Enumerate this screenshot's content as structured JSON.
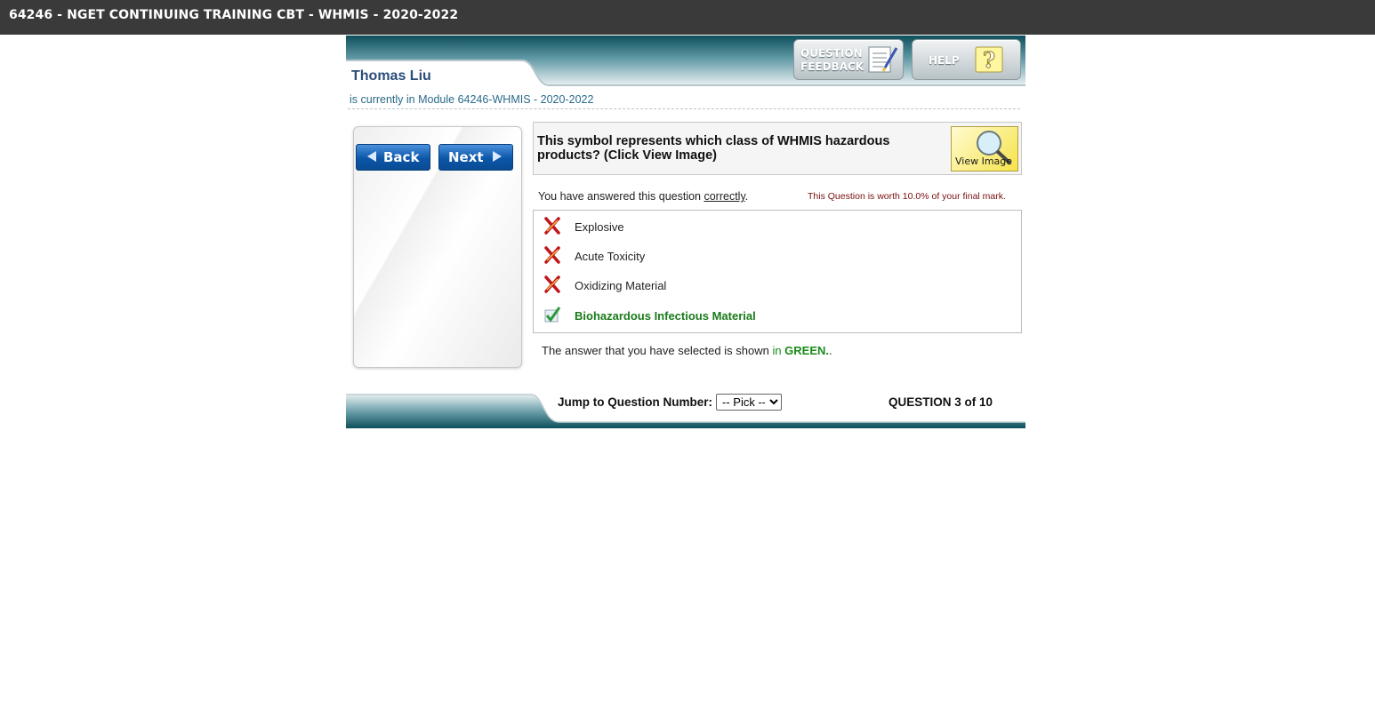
{
  "window": {
    "title": "64246 - NGET CONTINUING TRAINING CBT - WHMIS - 2020-2022"
  },
  "header": {
    "user_name": "Thomas Liu",
    "module_line": "is currently in Module 64246-WHMIS - 2020-2022",
    "question_feedback_line1": "QUESTION",
    "question_feedback_line2": "FEEDBACK",
    "help_label": "HELP"
  },
  "nav": {
    "back_label": "Back",
    "next_label": "Next"
  },
  "question": {
    "text": "This symbol represents which class of WHMIS hazardous products? (Click View Image)",
    "view_image_label": "View Image",
    "answered_prefix": "You have answered this question ",
    "answered_word": "correctly",
    "answered_suffix": ".",
    "worth": "This Question is worth 10.0% of your final mark."
  },
  "answers": [
    {
      "label": "Explosive",
      "status": "wrong"
    },
    {
      "label": "Acute Toxicity",
      "status": "wrong"
    },
    {
      "label": "Oxidizing Material",
      "status": "wrong"
    },
    {
      "label": "Biohazardous Infectious Material",
      "status": "correct"
    }
  ],
  "selection_note": {
    "prefix": "The answer that you have selected is shown ",
    "in": "in ",
    "color_word": "GREEN.",
    "suffix": "."
  },
  "footer": {
    "jump_label": "Jump to Question Number:",
    "jump_selected": "-- Pick --",
    "question_count": "QUESTION 3 of 10"
  },
  "colors": {
    "teal": "#0f5a68",
    "correct_green": "#1a7a1a",
    "wrong_red": "#c0141a"
  }
}
